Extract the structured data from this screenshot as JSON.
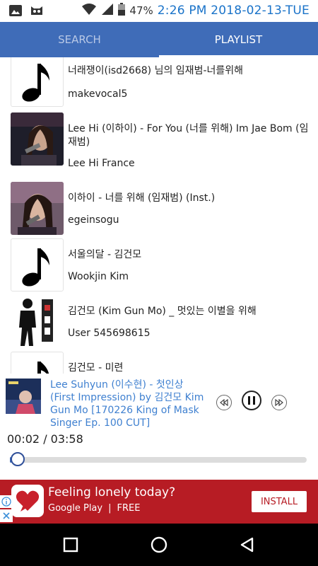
{
  "status_bar": {
    "battery_percent": "47%",
    "datetime": "2:26 PM 2018-02-13-TUE",
    "icons": [
      "image-icon",
      "cat-face-icon",
      "wifi-icon",
      "signal-icon",
      "battery-icon"
    ]
  },
  "tabs": [
    {
      "label": "SEARCH",
      "active": false
    },
    {
      "label": "PLAYLIST",
      "active": true
    }
  ],
  "playlist": [
    {
      "title": "너래쟁이(isd2668) 님의 임재범-너를위해",
      "channel": "makevocal5",
      "thumb": "music-note-icon"
    },
    {
      "title": "Lee Hi (이하이) - For You (너를 위해) Im Jae Bom (임재범)",
      "channel": "Lee Hi France",
      "thumb": "photo"
    },
    {
      "title": "이하이 - 너를 위해 (임재범) (Inst.)",
      "channel": "egeinsogu",
      "thumb": "photo"
    },
    {
      "title": "서울의달 - 김건모",
      "channel": "Wookjin Kim",
      "thumb": "music-note-icon"
    },
    {
      "title": "김건모 (Kim Gun Mo) _ 멋있는 이별을 위해",
      "channel": "User 545698615",
      "thumb": "photo"
    },
    {
      "title": "김건모 - 미련",
      "channel": "",
      "thumb": "music-note-icon"
    }
  ],
  "player": {
    "now_playing_title": "Lee Suhyun (이수현) - 첫인상 (First Impression) by 김건모 Kim Gun Mo [170226 King of Mask Singer Ep. 100 CUT]",
    "time_display": "00:02 / 03:58",
    "progress_fraction": 0.008
  },
  "ad": {
    "headline": "Feeling lonely today?",
    "store": "Google Play",
    "price": "FREE",
    "install_label": "INSTALL",
    "brand_color": "#b71c24"
  },
  "colors": {
    "accent": "#3f6cb8",
    "link": "#3f80d0"
  }
}
